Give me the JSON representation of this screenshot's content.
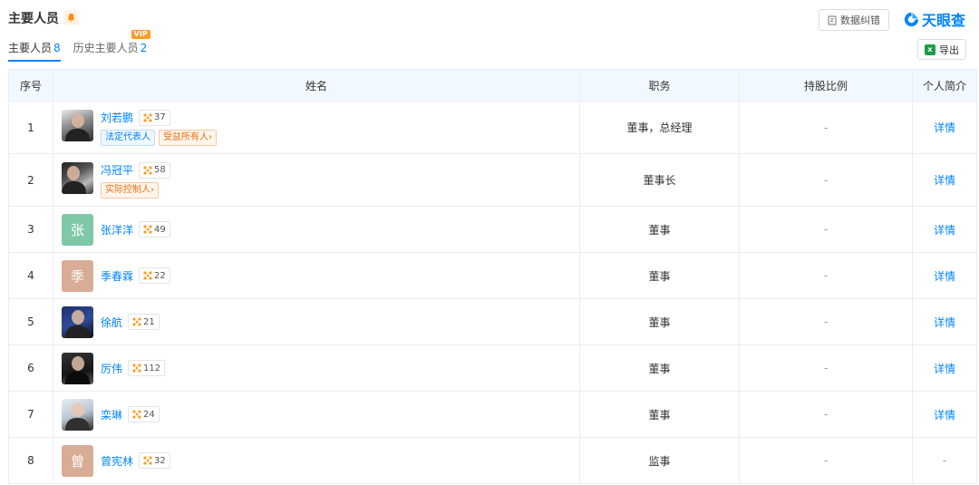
{
  "header": {
    "title": "主要人员",
    "correct_button": "数据纠错",
    "logo_text": "天眼查",
    "export_button": "导出",
    "export_icon_text": "x"
  },
  "tabs": [
    {
      "label": "主要人员",
      "count": "8",
      "active": true
    },
    {
      "label": "历史主要人员",
      "count": "2",
      "badge": "VIP"
    }
  ],
  "table": {
    "headers": [
      "序号",
      "姓名",
      "职务",
      "持股比例",
      "个人简介"
    ],
    "rows": [
      {
        "idx": "1",
        "name": "刘若鹏",
        "relations": "37",
        "tags": [
          "法定代表人",
          "受益所有人›"
        ],
        "position": "董事，总经理",
        "share": "-",
        "bio": "详情"
      },
      {
        "idx": "2",
        "name": "冯冠平",
        "relations": "58",
        "tags": [
          "实际控制人›"
        ],
        "position": "董事长",
        "share": "-",
        "bio": "详情"
      },
      {
        "idx": "3",
        "name": "张洋洋",
        "avatar_char": "张",
        "relations": "49",
        "position": "董事",
        "share": "-",
        "bio": "详情"
      },
      {
        "idx": "4",
        "name": "季春霖",
        "avatar_char": "季",
        "relations": "22",
        "position": "董事",
        "share": "-",
        "bio": "详情"
      },
      {
        "idx": "5",
        "name": "徐航",
        "relations": "21",
        "position": "董事",
        "share": "-",
        "bio": "详情"
      },
      {
        "idx": "6",
        "name": "厉伟",
        "relations": "112",
        "position": "董事",
        "share": "-",
        "bio": "详情"
      },
      {
        "idx": "7",
        "name": "栾琳",
        "relations": "24",
        "position": "董事",
        "share": "-",
        "bio": "详情"
      },
      {
        "idx": "8",
        "name": "曾宪林",
        "avatar_char": "曾",
        "relations": "32",
        "position": "监事",
        "share": "-",
        "bio": "-"
      }
    ]
  },
  "colors": {
    "accent": "#0084ff",
    "vip": "#ff9b26",
    "tag_orange": "#e86f14",
    "avatar_green": "#7ec8a8",
    "avatar_tan": "#d8ac95"
  }
}
